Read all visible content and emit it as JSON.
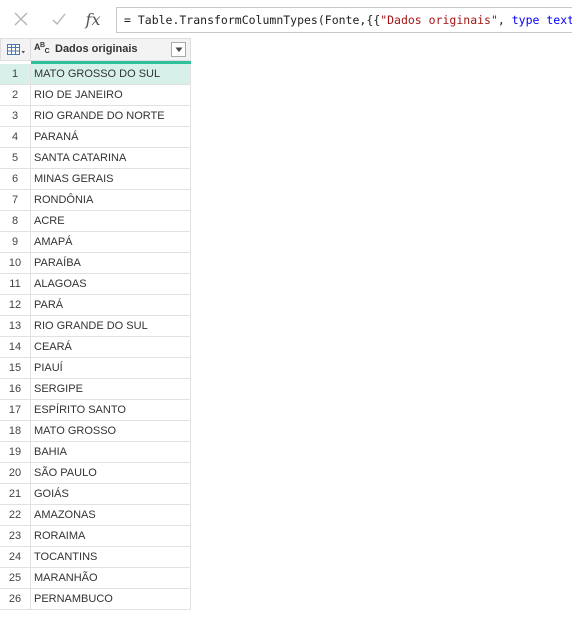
{
  "formula_bar": {
    "cancel_icon": "close-icon",
    "confirm_icon": "check-icon",
    "fx_label": "fx",
    "formula_prefix": "= Table.TransformColumnTypes(Fonte,{{",
    "formula_string": "\"Dados originais\"",
    "formula_sep": ", ",
    "formula_keyword": "type text",
    "formula_suffix": "}})"
  },
  "table": {
    "column": {
      "type_a": "A",
      "type_b": "B",
      "type_c": "C",
      "name": "Dados originais"
    },
    "selected_row": 1,
    "rows": [
      {
        "n": "1",
        "value": "MATO GROSSO DO SUL"
      },
      {
        "n": "2",
        "value": "RIO DE JANEIRO"
      },
      {
        "n": "3",
        "value": "RIO GRANDE DO NORTE"
      },
      {
        "n": "4",
        "value": "PARANÁ"
      },
      {
        "n": "5",
        "value": "SANTA CATARINA"
      },
      {
        "n": "6",
        "value": "MINAS GERAIS"
      },
      {
        "n": "7",
        "value": "RONDÔNIA"
      },
      {
        "n": "8",
        "value": "ACRE"
      },
      {
        "n": "9",
        "value": "AMAPÁ"
      },
      {
        "n": "10",
        "value": "PARAÍBA"
      },
      {
        "n": "11",
        "value": "ALAGOAS"
      },
      {
        "n": "12",
        "value": "PARÁ"
      },
      {
        "n": "13",
        "value": "RIO GRANDE DO SUL"
      },
      {
        "n": "14",
        "value": "CEARÁ"
      },
      {
        "n": "15",
        "value": "PIAUÍ"
      },
      {
        "n": "16",
        "value": "SERGIPE"
      },
      {
        "n": "17",
        "value": "ESPÍRITO SANTO"
      },
      {
        "n": "18",
        "value": "MATO GROSSO"
      },
      {
        "n": "19",
        "value": "BAHIA"
      },
      {
        "n": "20",
        "value": "SÃO PAULO"
      },
      {
        "n": "21",
        "value": "GOIÁS"
      },
      {
        "n": "22",
        "value": "AMAZONAS"
      },
      {
        "n": "23",
        "value": "RORAIMA"
      },
      {
        "n": "24",
        "value": "TOCANTINS"
      },
      {
        "n": "25",
        "value": "MARANHÃO"
      },
      {
        "n": "26",
        "value": "PERNAMBUCO"
      }
    ]
  },
  "colors": {
    "quality_bar": "#2fc29a",
    "selected_row": "#d8f0ea"
  }
}
